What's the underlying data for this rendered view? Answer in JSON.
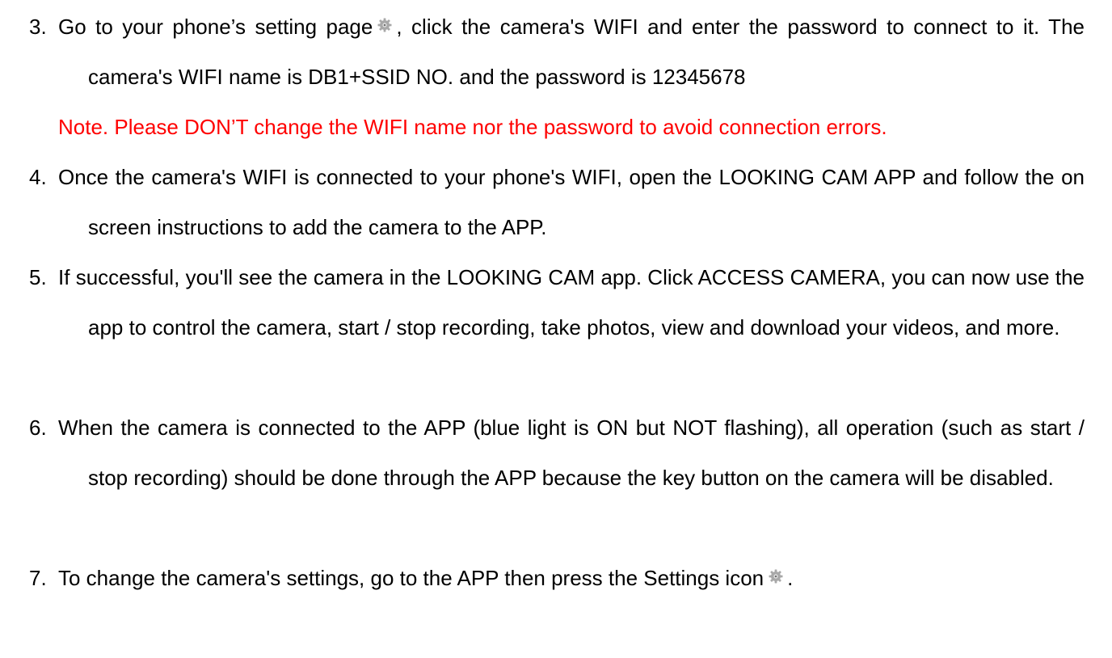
{
  "steps": [
    {
      "number": "3.",
      "text_before_icon": "Go to your phone’s setting page",
      "icon": "settings-gear-icon",
      "text_after_icon": ", click the camera's WIFI and enter the password to connect to it. The camera's WIFI name is DB1+SSID NO. and the password is 12345678",
      "note": "Note. Please DON’T change the WIFI name nor the password to avoid connection errors."
    },
    {
      "number": "4.",
      "text": "Once the camera's WIFI is connected to your phone's WIFI, open the LOOKING CAM APP and follow the on screen instructions to add the camera to the APP."
    },
    {
      "number": "5.",
      "text": "If successful, you'll see the camera in the LOOKING CAM app. Click ACCESS CAMERA, you can now use the app to control the camera, start / stop recording, take photos, view and download your videos, and more."
    },
    {
      "number": "6.",
      "text": "When the camera is connected to the APP (blue light is ON but NOT flashing), all operation (such as start / stop recording) should be done through the APP because the key button on the camera will be disabled."
    },
    {
      "number": "7.",
      "text_before_icon": "To change the camera's settings, go to the APP then press the Settings icon",
      "icon": "settings-gear-icon",
      "text_after_icon": "."
    }
  ],
  "colors": {
    "text": "#000000",
    "note": "#ff0000",
    "icon": "#9a9a9a"
  }
}
